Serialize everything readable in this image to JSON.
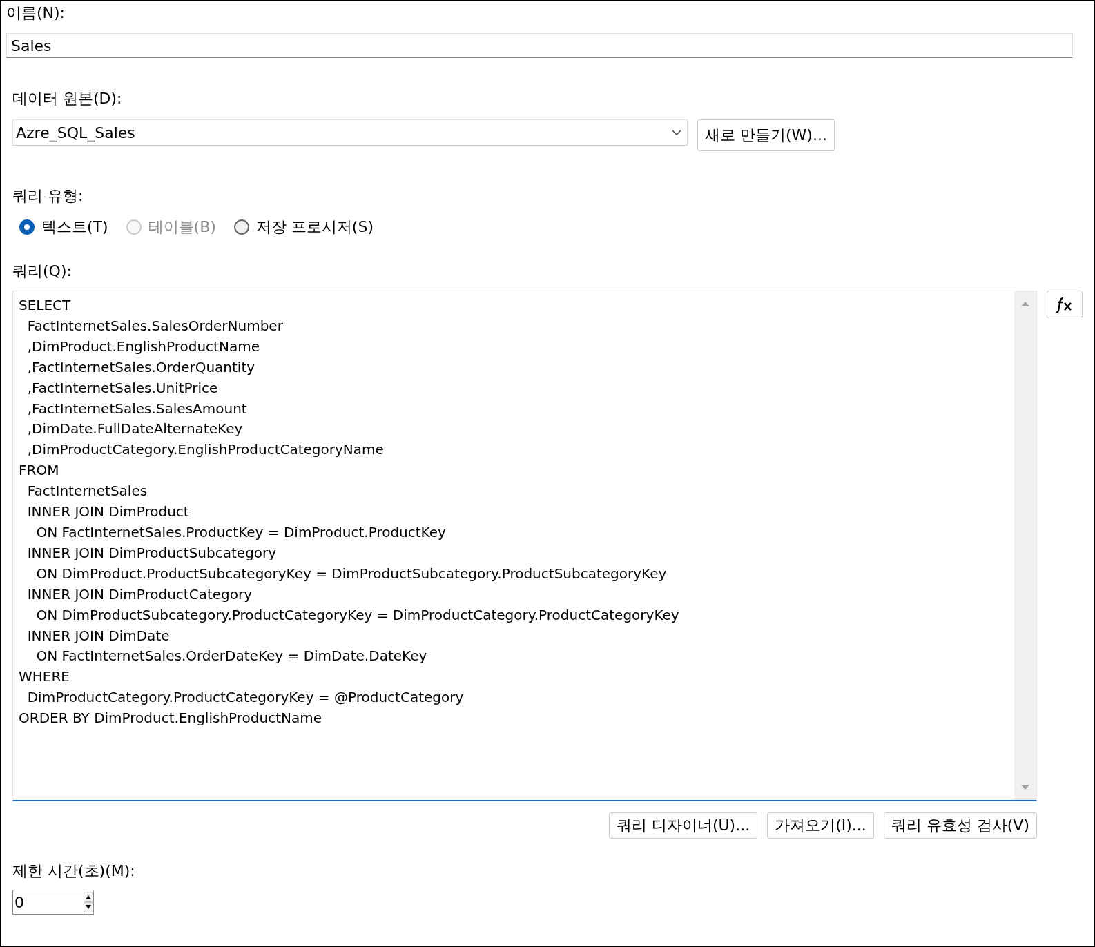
{
  "name_field": {
    "label": "이름(N):",
    "value": "Sales"
  },
  "data_source": {
    "label": "데이터 원본(D):",
    "value": "Azre_SQL_Sales",
    "new_button": "새로 만들기(W)..."
  },
  "query_type": {
    "label": "쿼리 유형:",
    "options": [
      {
        "label": "텍스트(T)",
        "selected": true,
        "disabled": false
      },
      {
        "label": "테이블(B)",
        "selected": false,
        "disabled": true
      },
      {
        "label": "저장 프로시저(S)",
        "selected": false,
        "disabled": false
      }
    ]
  },
  "query": {
    "label": "쿼리(Q):",
    "text": "SELECT\n  FactInternetSales.SalesOrderNumber\n  ,DimProduct.EnglishProductName\n  ,FactInternetSales.OrderQuantity\n  ,FactInternetSales.UnitPrice\n  ,FactInternetSales.SalesAmount\n  ,DimDate.FullDateAlternateKey\n  ,DimProductCategory.EnglishProductCategoryName\nFROM\n  FactInternetSales\n  INNER JOIN DimProduct\n    ON FactInternetSales.ProductKey = DimProduct.ProductKey\n  INNER JOIN DimProductSubcategory\n    ON DimProduct.ProductSubcategoryKey = DimProductSubcategory.ProductSubcategoryKey\n  INNER JOIN DimProductCategory\n    ON DimProductSubcategory.ProductCategoryKey = DimProductCategory.ProductCategoryKey\n  INNER JOIN DimDate\n    ON FactInternetSales.OrderDateKey = DimDate.DateKey\nWHERE\n  DimProductCategory.ProductCategoryKey = @ProductCategory\nORDER BY DimProduct.EnglishProductName"
  },
  "query_buttons": [
    "쿼리 디자이너(U)...",
    "가져오기(I)...",
    "쿼리 유효성 검사(V)"
  ],
  "timeout": {
    "label": "제한 시간(초)(M):",
    "value": "0"
  }
}
